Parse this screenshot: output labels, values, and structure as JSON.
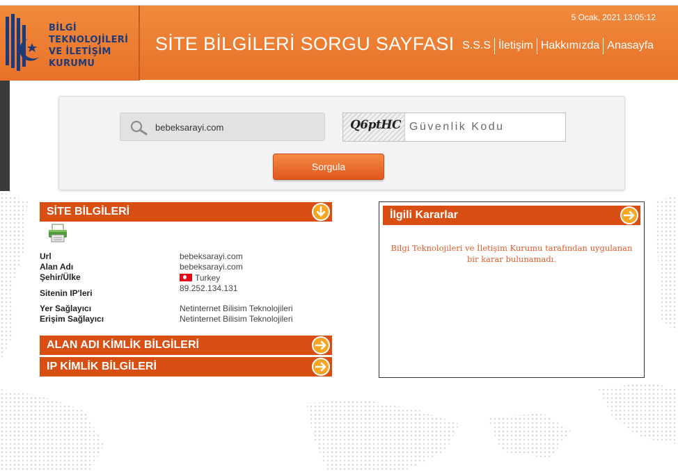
{
  "header": {
    "org_name": "BİLGİ\nTEKNOLOJİLERİ\nVE İLETİŞİM\nKURUMU",
    "title": "SİTE BİLGİLERİ SORGU SAYFASI",
    "date": "5 Ocak, 2021 13:05:12",
    "nav": [
      "S.S.S",
      "İletişim",
      "Hakkımızda",
      "Anasayfa"
    ]
  },
  "search": {
    "value": "bebeksarayi.com",
    "captcha_text": "Q6ptHC",
    "captcha_placeholder": "Güvenlik Kodu",
    "submit_label": "Sorgula"
  },
  "site_info": {
    "title": "SİTE BİLGİLERİ",
    "rows": [
      {
        "label": "Url",
        "value": "bebeksarayi.com"
      },
      {
        "label": "Alan Adı",
        "value": "bebeksarayi.com"
      },
      {
        "label": "Şehir/Ülke",
        "value": "Turkey"
      },
      {
        "label": "Sitenin IP'leri",
        "value": "89.252.134.131"
      },
      {
        "label": "Yer Sağlayıcı",
        "value": "Netinternet Bilisim Teknolojileri"
      },
      {
        "label": "Erişim Sağlayıcı",
        "value": "Netinternet Bilisim Teknolojileri"
      }
    ]
  },
  "domain_identity": {
    "title": "ALAN ADI KİMLİK BİLGİLERİ"
  },
  "ip_identity": {
    "title": "IP KİMLİK BİLGİLERİ"
  },
  "decisions": {
    "title": "İlgili Kararlar",
    "message": "Bilgi Teknolojileri ve İletişim Kurumu tarafından uygulanan bir karar bulunamadı."
  },
  "colors": {
    "header_orange": "#e8722a",
    "bar_orange": "#d94e12",
    "logo_blue": "#1e3a78",
    "message_text": "#e05a2a"
  }
}
